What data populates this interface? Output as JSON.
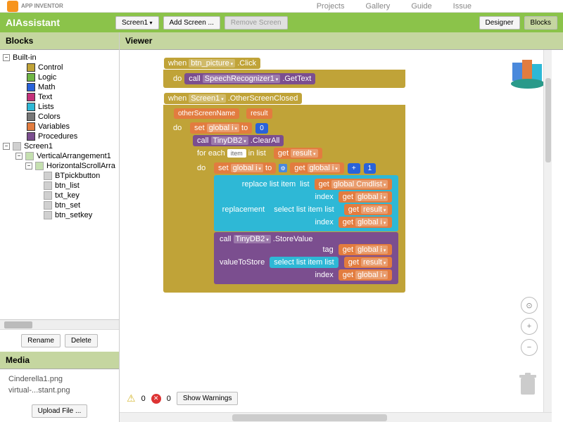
{
  "brand": "APP INVENTOR",
  "topNav": {
    "projects": "Projects",
    "gallery": "Gallery",
    "guide": "Guide",
    "issue": "Issue"
  },
  "appTitle": "AIAssistant",
  "titleButtons": {
    "screen": "Screen1",
    "addScreen": "Add Screen ...",
    "removeScreen": "Remove Screen",
    "designer": "Designer",
    "blocks": "Blocks"
  },
  "panels": {
    "blocks": "Blocks",
    "viewer": "Viewer",
    "media": "Media"
  },
  "tree": {
    "builtin": "Built-in",
    "categories": {
      "control": "Control",
      "logic": "Logic",
      "math": "Math",
      "text": "Text",
      "lists": "Lists",
      "colors": "Colors",
      "variables": "Variables",
      "procedures": "Procedures"
    },
    "screen1": "Screen1",
    "va": "VerticalArrangement1",
    "hsa": "HorizontalScrollArra",
    "components": {
      "btpick": "BTpickbutton",
      "btnlist": "btn_list",
      "txtkey": "txt_key",
      "btnset": "btn_set",
      "btnsetkey": "btn_setkey"
    }
  },
  "buttons": {
    "rename": "Rename",
    "delete": "Delete",
    "upload": "Upload File ...",
    "showWarnings": "Show Warnings"
  },
  "media": {
    "file1": "Cinderella1.png",
    "file2": "virtual-...stant.png"
  },
  "status": {
    "warn": "0",
    "err": "0"
  },
  "blocks": {
    "when": "when",
    "do": "do",
    "call": "call",
    "set": "set",
    "to": "to",
    "forEach": "for each",
    "inList": "in list",
    "get": "get",
    "replaceListItem": "replace list item",
    "list": "list",
    "index": "index",
    "replacement": "replacement",
    "selectListItem": "select list item",
    "tag": "tag",
    "valueToStore": "valueToStore",
    "btnPicture": "btn_picture",
    "click": ".Click",
    "speechRec": "SpeechRecognizer1",
    "getText": ".GetText",
    "screen1": "Screen1",
    "otherScreenClosed": ".OtherScreenClosed",
    "otherScreenName": "otherScreenName",
    "result": "result",
    "globalI": "global i",
    "globalCmdlist": "global Cmdlist",
    "tinyDB": "TinyDB2",
    "clearAll": ".ClearAll",
    "storeValue": ".StoreValue",
    "item": "item",
    "zero": "0",
    "one": "1",
    "plus": "+"
  }
}
